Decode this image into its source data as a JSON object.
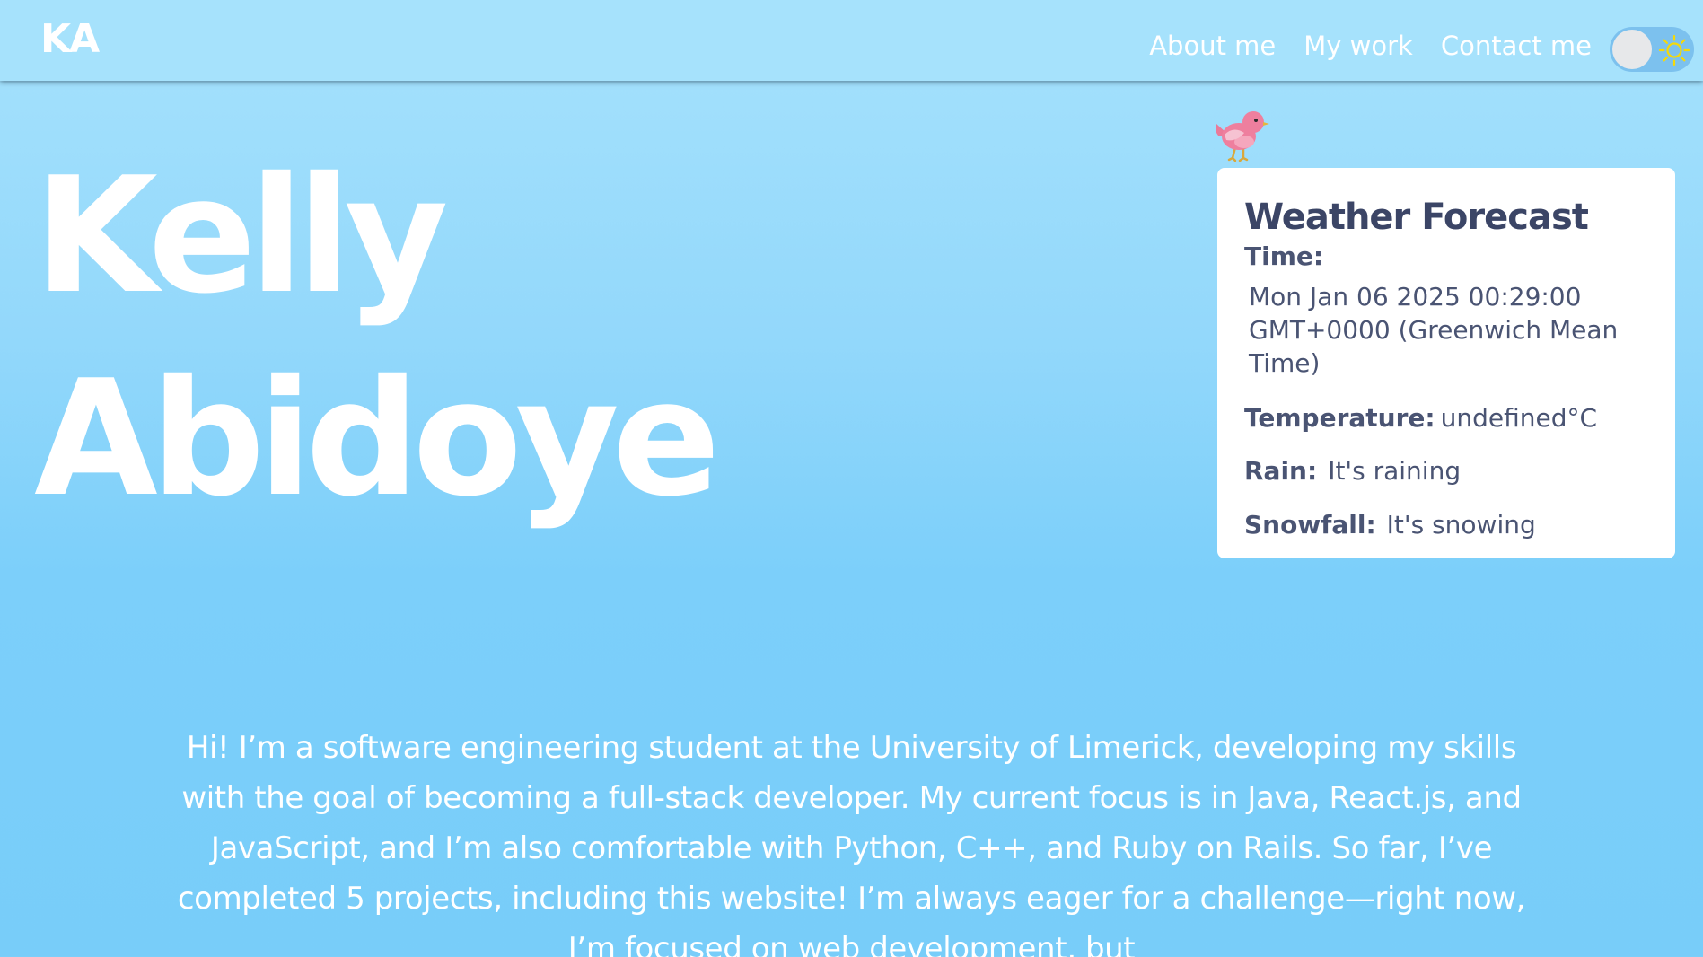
{
  "navbar": {
    "logo": "KA",
    "links": [
      {
        "label": "About me"
      },
      {
        "label": "My work"
      },
      {
        "label": "Contact me"
      }
    ],
    "theme_toggle": {
      "state": "light",
      "icon": "sun-icon"
    }
  },
  "hero": {
    "first_name": "Kelly",
    "last_name": "Abidoye"
  },
  "weather": {
    "mascot_icon": "bird-icon",
    "title": "Weather Forecast",
    "time_label": "Time:",
    "time_value": "Mon Jan 06 2025 00:29:00 GMT+0000 (Greenwich Mean Time)",
    "temperature_label": "Temperature:",
    "temperature_value": "undefined°C",
    "rain_label": "Rain:",
    "rain_value": "It's raining",
    "snowfall_label": "Snowfall:",
    "snowfall_value": "It's snowing"
  },
  "intro": {
    "text": "Hi! I’m a software engineering student at the University of Limerick, developing my skills with the goal of becoming a full-stack developer. My current focus is in Java, React.js, and JavaScript, and I’m also comfortable with Python, C++, and Ruby on Rails. So far, I’ve completed 5 projects, including this website! I’m always eager for a challenge—right now, I’m focused on web development, but"
  },
  "colors": {
    "background_top": "#a6e2fc",
    "background_bottom": "#78cdf9",
    "card_text": "#3b4566",
    "toggle_track": "#7cc1ee",
    "sun": "#f5d90a",
    "bird": "#ee7f9e"
  }
}
